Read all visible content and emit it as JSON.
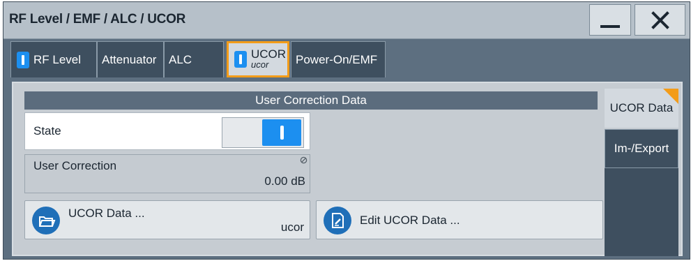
{
  "window": {
    "title": "RF Level / EMF / ALC / UCOR"
  },
  "tabs": [
    {
      "label": "RF Level"
    },
    {
      "label": "Attenuator"
    },
    {
      "label": "ALC"
    },
    {
      "label": "UCOR",
      "sublabel": "ucor"
    },
    {
      "label": "Power-On/EMF"
    }
  ],
  "section": {
    "title": "User Correction Data"
  },
  "state": {
    "label": "State"
  },
  "user_correction": {
    "label": "User Correction",
    "value": "0.00 dB"
  },
  "ucor_data_button": {
    "label": "UCOR Data ...",
    "value": "ucor"
  },
  "edit_button": {
    "label": "Edit UCOR Data ..."
  },
  "side_tabs": [
    {
      "label": "UCOR Data"
    },
    {
      "label": "Im-/Export"
    }
  ],
  "icons": {
    "toggle_on": "toggle-on-icon",
    "minimize": "minimize-icon",
    "close": "close-icon",
    "folder": "folder-icon",
    "edit": "edit-icon",
    "not_editable": "not-editable-icon"
  },
  "colors": {
    "accent_blue": "#1c8ff0",
    "highlight_orange": "#f39c19",
    "icon_blue": "#1f6fb8"
  }
}
